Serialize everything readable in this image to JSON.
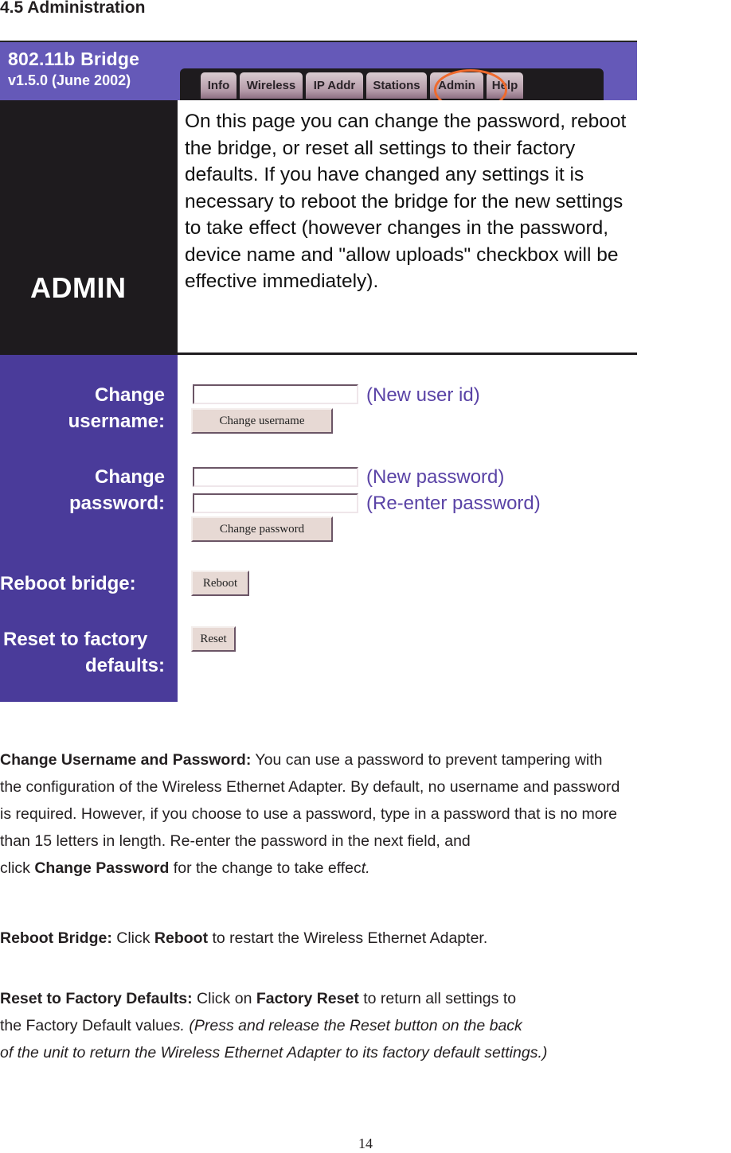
{
  "document": {
    "section_title": "4.5 Administration",
    "page_number": "14"
  },
  "screenshot": {
    "brand_title": "802.11b Bridge",
    "brand_version": "v1.5.0 (June 2002)",
    "tabs": [
      {
        "label": "Info"
      },
      {
        "label": "Wireless"
      },
      {
        "label": "IP Addr"
      },
      {
        "label": "Stations"
      },
      {
        "label": "Admin",
        "highlighted": true
      },
      {
        "label": "Help"
      }
    ],
    "highlight_color": "#ef6a2d",
    "page_heading": "ADMIN",
    "description": "On this page you can change the password, reboot the bridge, or reset all settings to their factory defaults. If you have changed any settings it is necessary to reboot the bridge for the new settings to take effect (however changes in the password, device name and \"allow uploads\" checkbox will be effective immediately).",
    "form": {
      "change_username_label_1": "Change",
      "change_username_label_2": "username:",
      "username_value": "",
      "username_hint": "(New user id)",
      "change_username_button": "Change username",
      "change_password_label_1": "Change",
      "change_password_label_2": "password:",
      "new_password_value": "",
      "new_password_hint": "(New password)",
      "reenter_password_value": "",
      "reenter_password_hint": "(Re-enter password)",
      "change_password_button": "Change password",
      "reboot_label": "Reboot bridge:",
      "reboot_button": "Reboot",
      "reset_label_1": "Reset to factory",
      "reset_label_2": "defaults:",
      "reset_button": "Reset"
    },
    "colors": {
      "header_purple": "#6559b8",
      "sidebar_purple": "#4a3b9a",
      "hint_purple": "#5a43a6",
      "tab_bar": "#1e1b1e",
      "button_face": "#e7d9d4"
    }
  },
  "body": {
    "p1": {
      "bold_lead": "Change Username and Password:",
      "line1_rest": " You can use a password to prevent tampering with",
      "line2": "the configuration of the Wireless Ethernet Adapter. By default, no username and password",
      "line3": "is required. However, if you choose to use a password, type in a password that is no more",
      "line4": "than 15 letters in length. Re-enter the password in the next field, and",
      "line5_pre": "click ",
      "line5_bold": "Change Password",
      "line5_post": " for the change to take effec",
      "line5_italic": "t."
    },
    "p2": {
      "bold_lead": "Reboot Bridge:",
      "mid": " Click ",
      "bold_action": "Reboot",
      "rest": " to restart the Wireless Ethernet Adapter."
    },
    "p3": {
      "bold_lead": "Reset to Factory Defaults:",
      "mid": " Click on ",
      "bold_action": "Factory Reset",
      "rest": " to return all settings to",
      "line2_plain": "the Factory Default value",
      "line2_italic": "s. (Press and release the Reset button on the back",
      "line3_italic": "of the unit to return the Wireless Ethernet Adapter to its factory default settings.)"
    }
  }
}
